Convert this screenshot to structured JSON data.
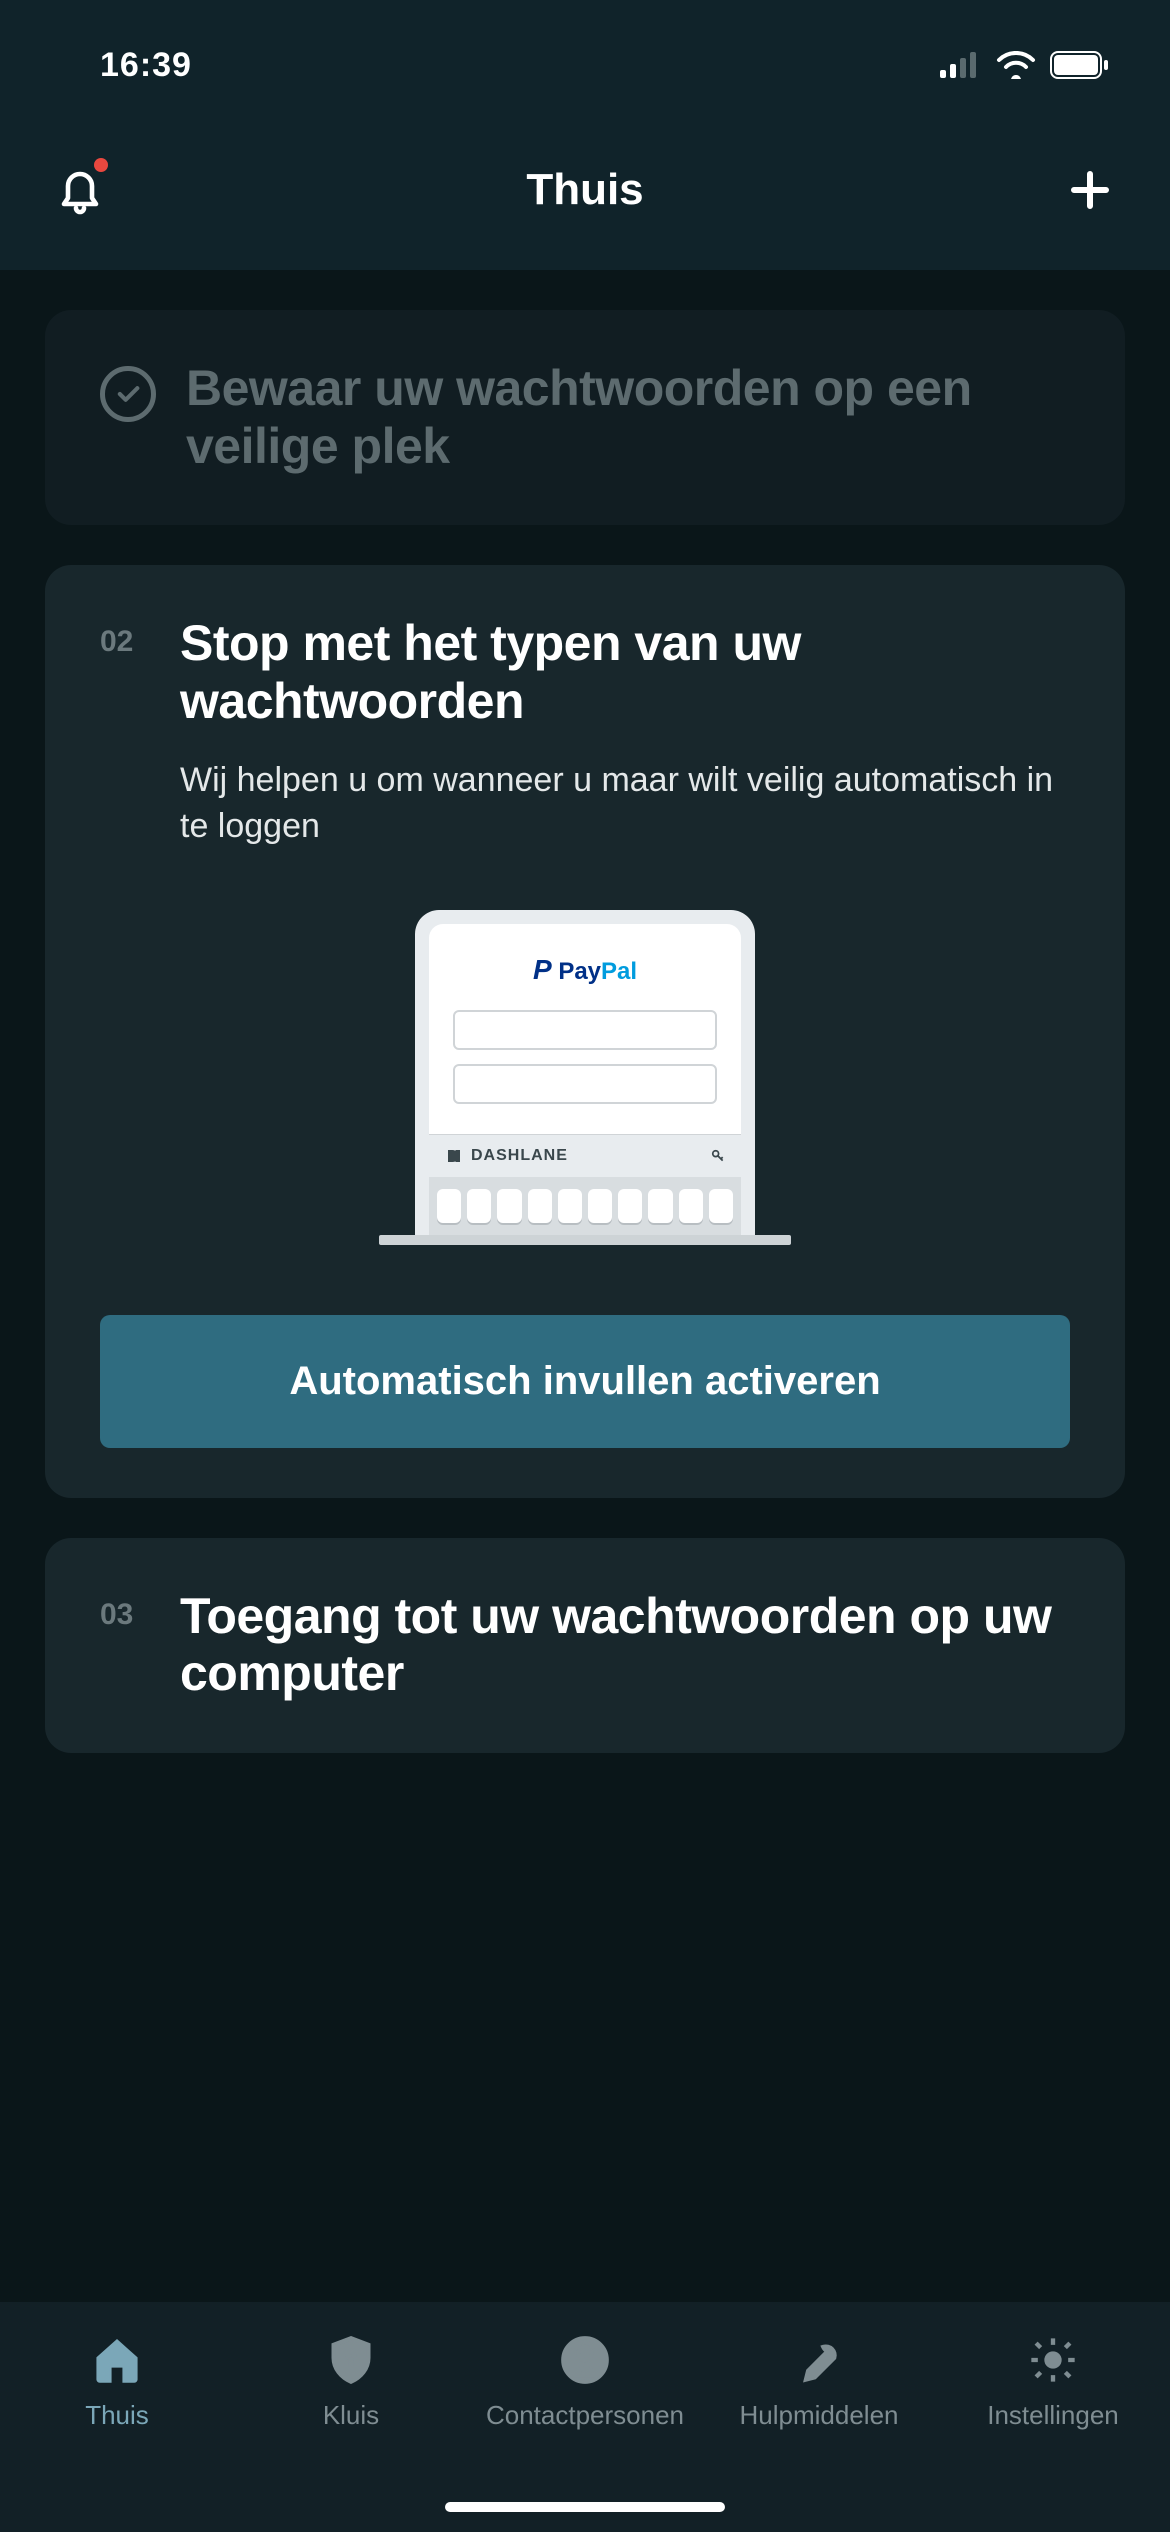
{
  "status": {
    "time": "16:39"
  },
  "header": {
    "title": "Thuis"
  },
  "steps": {
    "completed": {
      "title": "Bewaar uw wachtwoorden op een veilige plek"
    },
    "step2": {
      "num": "02",
      "title": "Stop met het typen van uw wachtwoorden",
      "subtitle": "Wij helpen u om wanneer u maar wilt veilig automatisch in te loggen",
      "cta": "Automatisch invullen activeren",
      "illustration": {
        "brand_pay": "Pay",
        "brand_pal": "Pal",
        "autofill_label": "DASHLANE"
      }
    },
    "step3": {
      "num": "03",
      "title": "Toegang tot uw wachtwoorden op uw computer"
    }
  },
  "tabs": {
    "home": "Thuis",
    "vault": "Kluis",
    "contacts": "Contactpersonen",
    "tools": "Hulpmiddelen",
    "settings": "Instellingen"
  }
}
